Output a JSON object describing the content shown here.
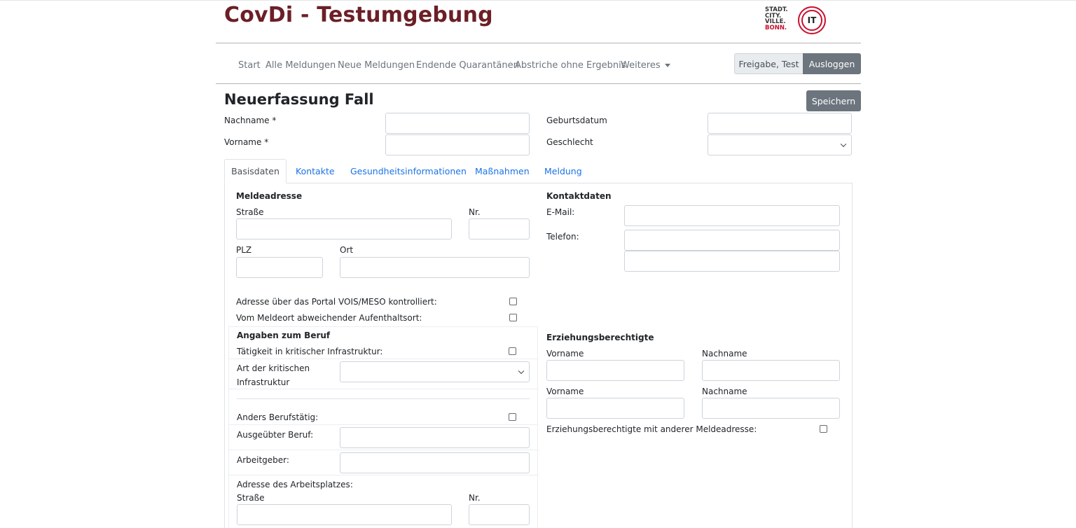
{
  "header": {
    "app_title": "CovDi - Testumgebung",
    "logo_lines": [
      "STADT.",
      "CITY.",
      "VILLE.",
      "BONN."
    ],
    "it_logo": "IT"
  },
  "nav": {
    "items": [
      "Start",
      "Alle Meldungen",
      "Neue Meldungen",
      "Endende Quarantänen",
      "Abstriche ohne Ergebnis",
      "Weiteres"
    ],
    "user_label": "Freigabe, Test",
    "logout_label": "Ausloggen"
  },
  "page": {
    "title": "Neuerfassung Fall",
    "save_label": "Speichern"
  },
  "person": {
    "nachname_label": "Nachname *",
    "vorname_label": "Vorname *",
    "geburtsdatum_label": "Geburtsdatum",
    "geschlecht_label": "Geschlecht"
  },
  "tabs": [
    "Basisdaten",
    "Kontakte",
    "Gesundheitsinformationen",
    "Maßnahmen",
    "Meldung"
  ],
  "meldeadresse": {
    "title": "Meldeadresse",
    "strasse": "Straße",
    "nr": "Nr.",
    "plz": "PLZ",
    "ort": "Ort",
    "vois_label": "Adresse über das Portal VOIS/MESO kontrolliert:",
    "abweichend_label": "Vom Meldeort abweichender Aufenthaltsort:"
  },
  "kontaktdaten": {
    "title": "Kontaktdaten",
    "email": "E-Mail:",
    "telefon": "Telefon:"
  },
  "beruf": {
    "title": "Angaben zum Beruf",
    "kritisch_label": "Tätigkeit in kritischer Infrastruktur:",
    "art_label_1": "Art der kritischen",
    "art_label_2": "Infrastruktur",
    "anders_label": "Anders Berufstätig:",
    "beruf_label": "Ausgeübter Beruf:",
    "arbeitgeber_label": "Arbeitgeber:",
    "adresse_label": "Adresse des Arbeitsplatzes:",
    "strasse": "Straße",
    "nr": "Nr."
  },
  "erziehung": {
    "title": "Erziehungsberechtigte",
    "vorname": "Vorname",
    "nachname": "Nachname",
    "andere_adresse_label": "Erziehungsberechtigte mit anderer Meldeadresse:"
  }
}
